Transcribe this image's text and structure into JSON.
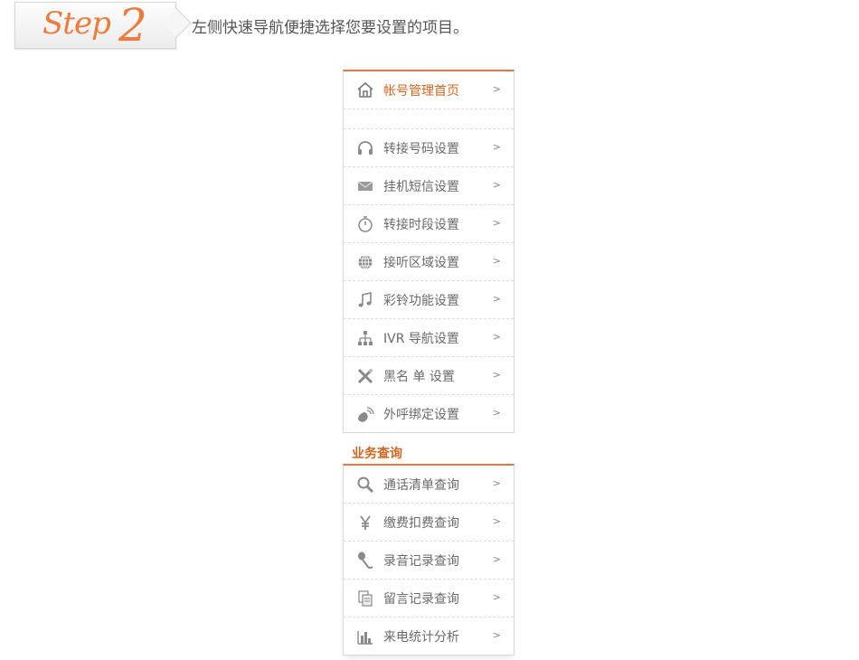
{
  "step": {
    "word": "Step",
    "number": "2",
    "instruction": "左侧快速导航便捷选择您要设置的项目。"
  },
  "menu_main": {
    "items": [
      {
        "label": "帐号管理首页",
        "icon": "home-icon",
        "active": true
      },
      {
        "label": "转接号码设置",
        "icon": "headset-icon"
      },
      {
        "label": "挂机短信设置",
        "icon": "envelope-icon"
      },
      {
        "label": "转接时段设置",
        "icon": "stopwatch-icon"
      },
      {
        "label": "接听区域设置",
        "icon": "globe-icon"
      },
      {
        "label": "彩铃功能设置",
        "icon": "music-note-icon"
      },
      {
        "label": "IVR 导航设置",
        "icon": "sitemap-icon"
      },
      {
        "label": "黑名 单 设置",
        "icon": "blacklist-icon"
      },
      {
        "label": "外呼绑定设置",
        "icon": "satellite-icon"
      }
    ]
  },
  "section2": {
    "title": "业务查询"
  },
  "menu_query": {
    "items": [
      {
        "label": "通话清单查询",
        "icon": "search-icon"
      },
      {
        "label": "缴费扣费查询",
        "icon": "yen-icon"
      },
      {
        "label": "录音记录查询",
        "icon": "microphone-icon"
      },
      {
        "label": "留言记录查询",
        "icon": "documents-icon"
      },
      {
        "label": "来电统计分析",
        "icon": "bar-chart-icon"
      }
    ]
  },
  "arrow": ">"
}
